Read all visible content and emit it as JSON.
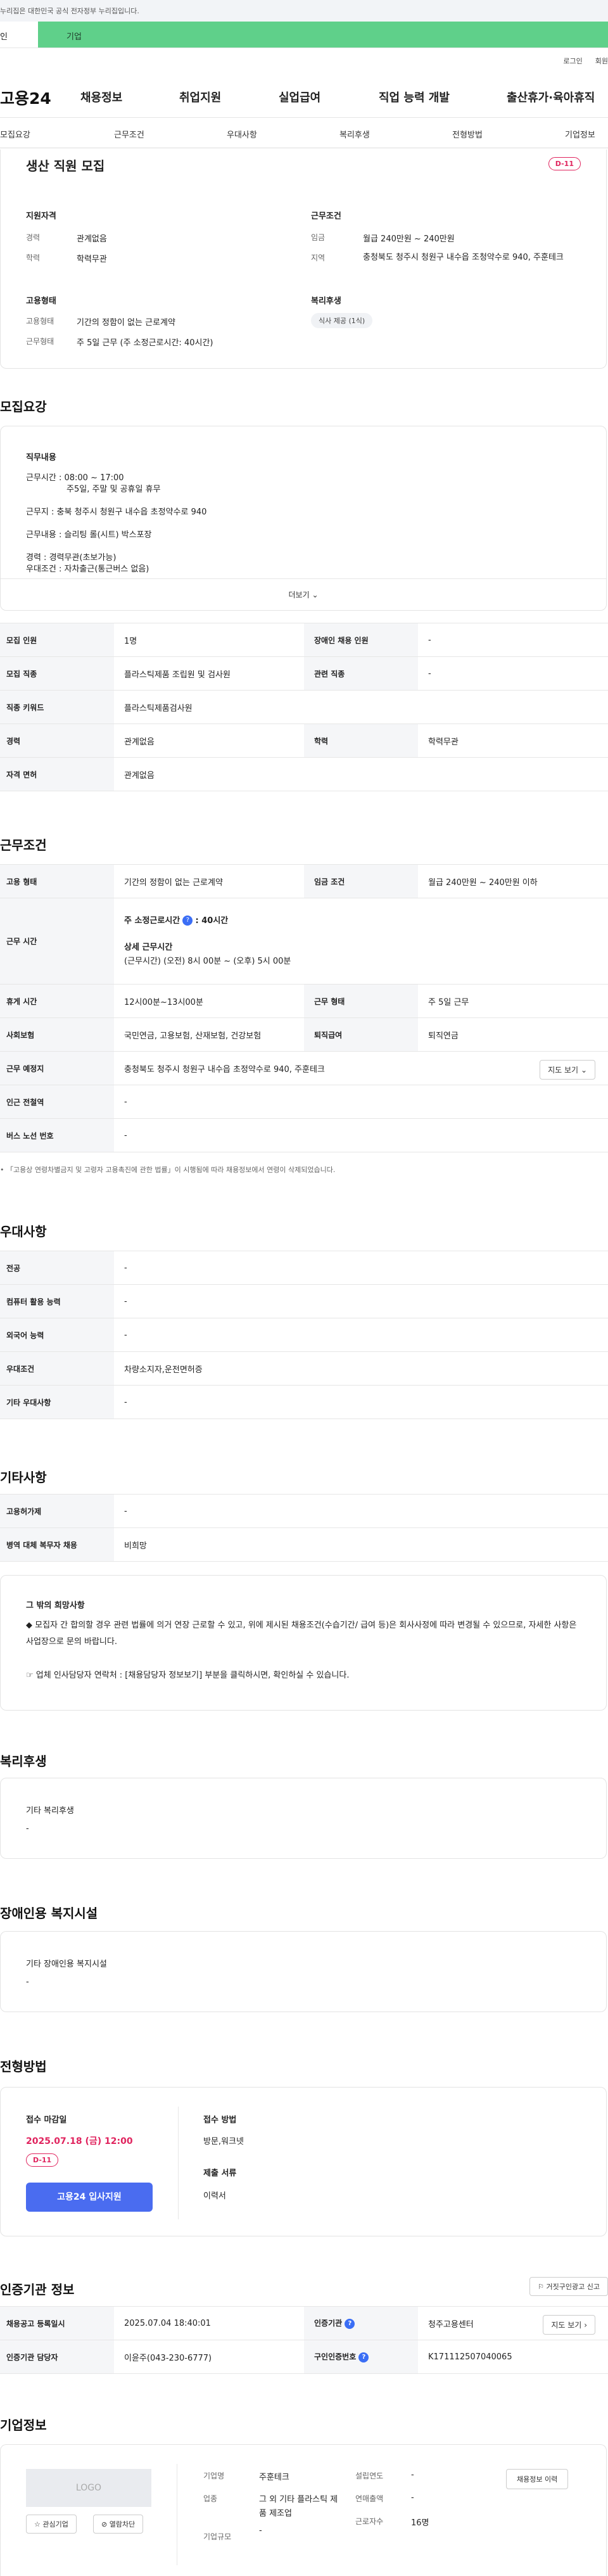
{
  "gov_banner": "누리집은 대한민국 공식 전자정부 누리집입니다.",
  "tabs": [
    "인",
    "기업"
  ],
  "util": [
    "로그인",
    "회원"
  ],
  "logo": "고용24",
  "gnb": [
    "채용정보",
    "취업지원",
    "실업급여",
    "직업 능력 개발",
    "출산휴가·육아휴직"
  ],
  "subnav": [
    "모집요강",
    "근무조건",
    "우대사항",
    "복리후생",
    "전형방법",
    "기업정보"
  ],
  "summary": {
    "title": "생산 직원 모집",
    "dday": "D-11",
    "req_title": "지원자격",
    "req": [
      [
        "경력",
        "관계없음"
      ],
      [
        "학력",
        "학력무관"
      ]
    ],
    "cond_title": "근무조건",
    "cond": [
      [
        "임금",
        "월급 240만원 ~ 240만원"
      ],
      [
        "지역",
        "충청북도 청주시 청원구 내수읍 조청약수로 940, 주훈테크"
      ]
    ],
    "emp_title": "고용형태",
    "emp": [
      [
        "고용형태",
        "기간의 정함이 없는 근로계약"
      ],
      [
        "근무형태",
        "주 5일 근무 (주 소정근로시간: 40시간)"
      ]
    ],
    "welfare_title": "복리후생",
    "welfare_chip": "식사 제공 (1식)"
  },
  "recruit": {
    "title": "모집요강",
    "job_title": "직무내용",
    "job_lines": [
      "근무시간 : 08:00 ~ 17:00",
      "주5일, 주말 및 공휴일 휴무",
      "근무지 : 충북 청주시 청원구 내수읍 초정약수로 940",
      "근무내용 : 슬리팅 롤(시트) 박스포장",
      "경력 : 경력무관(초보가능)",
      "우대조건 : 자차출근(통근버스 없음)"
    ],
    "more": "더보기",
    "rows": [
      [
        "모집 인원",
        "1명",
        "장애인 채용 인원",
        "-"
      ],
      [
        "모집 직종",
        "플라스틱제품 조립원 및 검사원",
        "관련 직종",
        "-"
      ],
      [
        "직종 키워드",
        "플라스틱제품검사원",
        "",
        ""
      ],
      [
        "경력",
        "관계없음",
        "학력",
        "학력무관"
      ],
      [
        "자격 면허",
        "관계없음",
        "",
        ""
      ]
    ]
  },
  "work": {
    "title": "근무조건",
    "r1": [
      "고용 형태",
      "기간의 정함이 없는 근로계약",
      "임금 조건",
      "월급 240만원 ~ 240만원 이하"
    ],
    "hours_key": "근무 시간",
    "hours_main": "주 소정근로시간",
    "hours_main_val": ": 40시간",
    "hours_detail_title": "상세 근무시간",
    "hours_detail": "(근무시간) (오전) 8시 00분 ~ (오후) 5시 00분",
    "r3": [
      "휴게 시간",
      "12시00분~13시00분",
      "근무 형태",
      "주 5일 근무"
    ],
    "r4": [
      "사회보험",
      "국민연금, 고용보험, 산재보험, 건강보험",
      "퇴직급여",
      "퇴직연금"
    ],
    "addr_key": "근무 예정지",
    "addr": "충청북도 청주시 청원구 내수읍 초정약수로 940, 주훈테크",
    "map_btn": "지도 보기",
    "r6": [
      "인근 전철역",
      "-"
    ],
    "r7": [
      "버스 노선 번호",
      "-"
    ],
    "note": "「고용상 연령차별금지 및 고령자 고용촉진에 관한 법률」이 시행됨에 따라 채용정보에서 연령이 삭제되었습니다."
  },
  "pref": {
    "title": "우대사항",
    "rows": [
      [
        "전공",
        "-"
      ],
      [
        "컴퓨터 활용 능력",
        "-"
      ],
      [
        "외국어 능력",
        "-"
      ],
      [
        "우대조건",
        "차량소지자,운전면허증"
      ],
      [
        "기타 우대사항",
        "-"
      ]
    ]
  },
  "etc": {
    "title": "기타사항",
    "rows": [
      [
        "고용허가제",
        "-"
      ],
      [
        "병역 대체 복무자 채용",
        "비희망"
      ]
    ],
    "box_title": "그 밖의 희망사항",
    "box_line1": "◆ 모집자 간 합의할 경우 관련 법률에 의거 연장 근로할 수 있고, 위에 제시된 채용조건(수습기간/ 급여 등)은 회사사정에 따라 변경될 수 있으므로, 자세한 사항은 사업장으로 문의 바랍니다.",
    "box_line2": "☞ 업체 인사담당자 연락처 : [채용담당자 정보보기] 부분을 클릭하시면, 확인하실 수 있습니다."
  },
  "benefit": {
    "title": "복리후생",
    "label": "기타 복리후생",
    "value": "-"
  },
  "disab": {
    "title": "장애인용 복지시설",
    "label": "기타 장애인용 복지시설",
    "value": "-"
  },
  "apply": {
    "title": "전형방법",
    "deadline_label": "접수 마감일",
    "deadline": "2025.07.18 (금) 12:00",
    "dday": "D-11",
    "apply_btn": "고용24 입사지원",
    "method_label": "접수 방법",
    "method": "방문,워크넷",
    "docs_label": "제출 서류",
    "docs": "이력서"
  },
  "cert": {
    "title": "인증기관 정보",
    "report_btn": "거짓구인광고 신고",
    "r1": [
      "채용공고 등록일시",
      "2025.07.04 18:40:01",
      "인증기관",
      "청주고용센터"
    ],
    "r2": [
      "인증기관 담당자",
      "이윤주(043-230-6777)",
      "구인인증번호",
      "K171112507040065"
    ],
    "map_btn": "지도 보기"
  },
  "company": {
    "title": "기업정보",
    "logo": "LOGO",
    "fav": "관심기업",
    "block": "열람차단",
    "rows": [
      [
        "기업명",
        "주훈테크",
        "설립연도",
        "-"
      ],
      [
        "업종",
        "그 외 기타 플라스틱 제품 제조업",
        "연매출액",
        "-"
      ],
      [
        "기업규모",
        "-",
        "근로자수",
        "16명"
      ]
    ],
    "history_btn": "채용정보 이력"
  },
  "colors": {
    "brand_green": "#5fd08a",
    "dday_pink": "#e0245e",
    "apply_blue": "#4a6cf0"
  }
}
